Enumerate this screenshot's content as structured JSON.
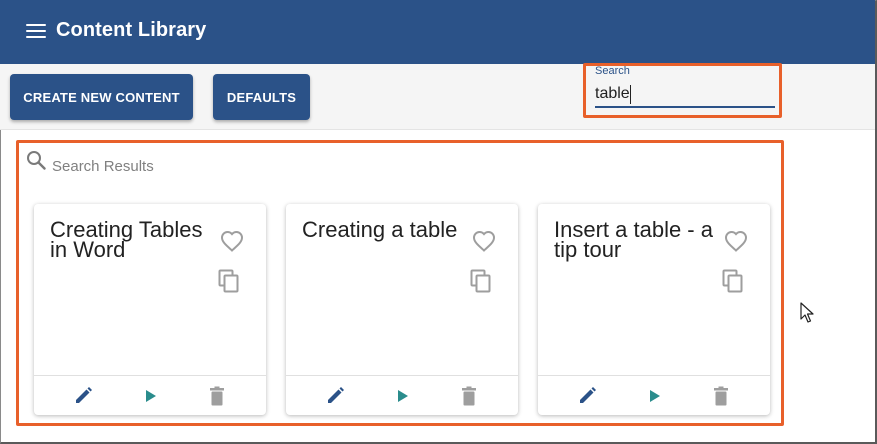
{
  "header": {
    "title": "Content Library",
    "menu_icon": "hamburger-menu-icon",
    "color": "#2b5288"
  },
  "toolbar": {
    "create_label": "CREATE NEW CONTENT",
    "defaults_label": "DEFAULTS"
  },
  "search": {
    "label": "Search",
    "value": "table"
  },
  "results": {
    "label": "Search Results",
    "cards": [
      {
        "title": "Creating Tables in Word"
      },
      {
        "title": "Creating a table"
      },
      {
        "title": "Insert a table - a tip tour"
      }
    ]
  },
  "colors": {
    "highlight": "#e8602a",
    "accent": "#2b5288",
    "play": "#2a8c8c",
    "icon_grey": "#9e9e9e"
  }
}
